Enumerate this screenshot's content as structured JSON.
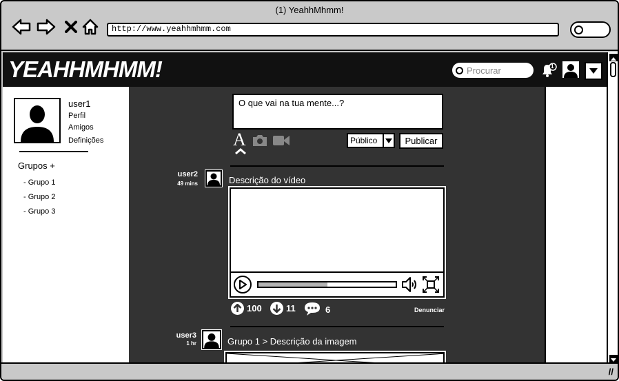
{
  "window": {
    "title": "(1) YeahhMhmm!"
  },
  "browser": {
    "url": "http://www.yeahhmhmm.com",
    "nav_icons": [
      "back-arrow-icon",
      "forward-arrow-icon",
      "stop-icon",
      "home-icon"
    ]
  },
  "header": {
    "logo": "YEAHHMHMM!",
    "search_placeholder": "Procurar",
    "notification_count": "1"
  },
  "sidebar": {
    "username": "user1",
    "links": [
      "Perfil",
      "Amigos",
      "Definições"
    ],
    "groups_title": "Grupos +",
    "groups": [
      "- Grupo 1",
      "- Grupo 2",
      "- Grupo 3"
    ]
  },
  "composer": {
    "placeholder": "O que vai na tua mente...?",
    "text_tool": "A",
    "visibility": "Público",
    "publish_label": "Publicar"
  },
  "posts": [
    {
      "user": "user2",
      "time": "49 mins",
      "title": "Descrição do vídeo",
      "video_progress": 0.5,
      "upvotes": "100",
      "downvotes": "11",
      "comments": "6",
      "report_label": "Denunciar"
    },
    {
      "user": "user3",
      "time": "1 hr",
      "title": "Grupo 1 > Descrição da imagem"
    }
  ]
}
